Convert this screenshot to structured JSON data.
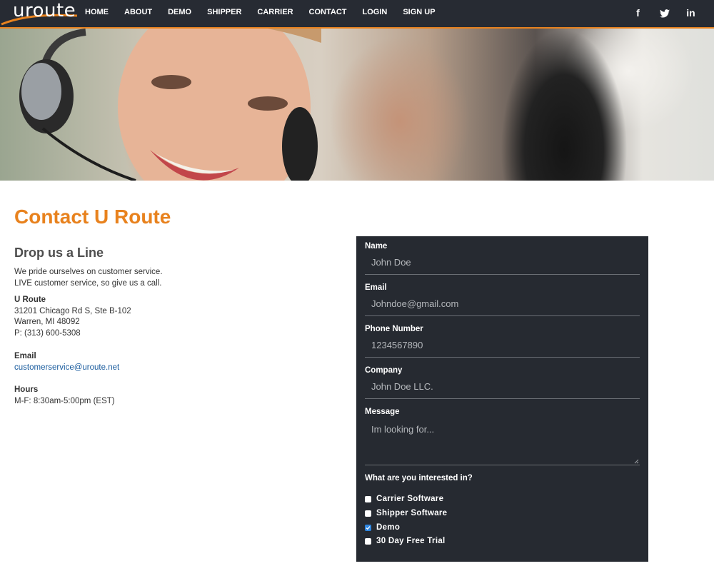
{
  "brand": {
    "logo_text": "uroute",
    "accent": "#e8821e",
    "header_bg": "#272b33"
  },
  "nav": {
    "items": [
      {
        "key": "home",
        "label": "HOME"
      },
      {
        "key": "about",
        "label": "ABOUT"
      },
      {
        "key": "demo",
        "label": "DEMO"
      },
      {
        "key": "shipper",
        "label": "SHIPPER"
      },
      {
        "key": "carrier",
        "label": "CARRIER"
      },
      {
        "key": "contact",
        "label": "CONTACT"
      },
      {
        "key": "login",
        "label": "LOGIN"
      },
      {
        "key": "signup",
        "label": "SIGN UP"
      }
    ],
    "social": [
      {
        "name": "facebook-icon",
        "glyph": "f"
      },
      {
        "name": "twitter-icon",
        "glyph": "🐦"
      },
      {
        "name": "linkedin-icon",
        "glyph": "in"
      }
    ]
  },
  "contact": {
    "title": "Contact U Route",
    "subheading": "Drop us a Line",
    "intro_line1": "We pride ourselves on customer service.",
    "intro_line2": "LIVE customer service, so give us a call.",
    "company_name": "U Route",
    "address_line1": "31201 Chicago Rd S, Ste B-102",
    "address_line2": "Warren, MI 48092",
    "phone": "P: (313) 600-5308",
    "email_label": "Email",
    "email": "customerservice@uroute.net",
    "hours_label": "Hours",
    "hours": "M-F: 8:30am-5:00pm (EST)"
  },
  "form": {
    "name_label": "Name",
    "name_placeholder": "John Doe",
    "email_label": "Email",
    "email_placeholder": "Johndoe@gmail.com",
    "phone_label": "Phone Number",
    "phone_placeholder": "1234567890",
    "company_label": "Company",
    "company_placeholder": "John Doe LLC.",
    "message_label": "Message",
    "message_placeholder": "Im looking for...",
    "interest_label": "What are you interested in?",
    "options": [
      {
        "label": "Carrier Software",
        "checked": false
      },
      {
        "label": "Shipper Software",
        "checked": false
      },
      {
        "label": "Demo",
        "checked": true
      },
      {
        "label": "30 Day Free Trial",
        "checked": false
      }
    ]
  }
}
